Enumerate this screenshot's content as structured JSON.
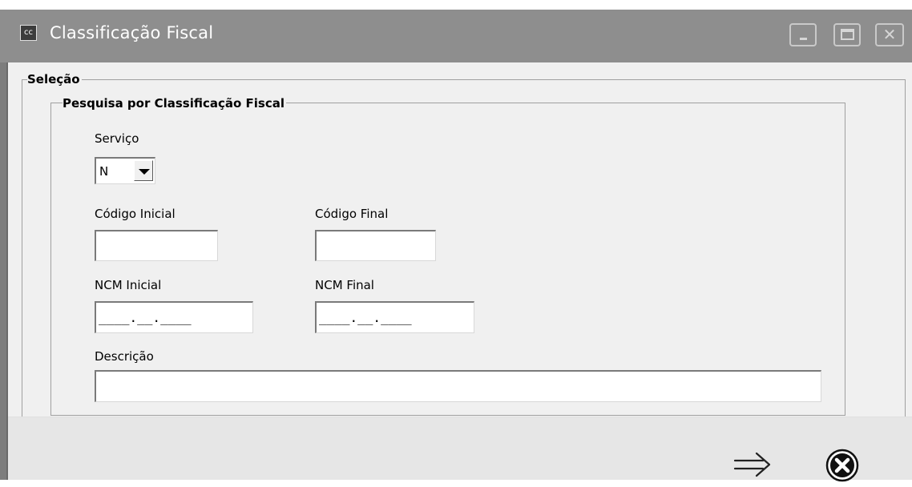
{
  "window": {
    "icon_text": "cc",
    "title": "Classificação Fiscal"
  },
  "group_selecao": {
    "label": "Seleção"
  },
  "group_pesquisa": {
    "label": "Pesquisa por Classificação Fiscal"
  },
  "servico": {
    "label": "Serviço",
    "selected": "N"
  },
  "codigo_inicial": {
    "label": "Código Inicial",
    "value": ""
  },
  "codigo_final": {
    "label": "Código Final",
    "value": ""
  },
  "ncm_inicial": {
    "label": "NCM Inicial",
    "value": "____.__.____"
  },
  "ncm_final": {
    "label": "NCM Final",
    "value": "____.__.____"
  },
  "descricao": {
    "label": "Descrição",
    "value": ""
  },
  "icons": {
    "confirm": "right-double-arrow-icon",
    "cancel": "circle-x-icon",
    "minimize": "minimize-icon",
    "maximize": "maximize-icon",
    "close": "close-icon"
  }
}
